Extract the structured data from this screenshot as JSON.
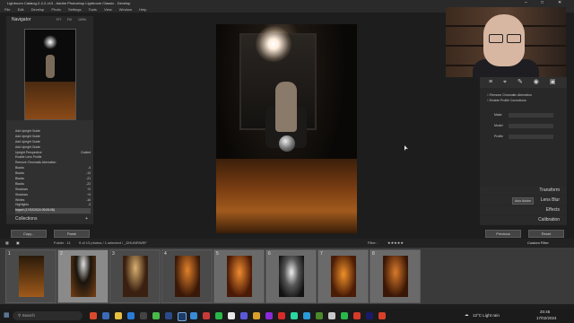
{
  "window": {
    "title": "Lightroom Catalog-2-2-2-v13 - Adobe Photoshop Lightroom Classic - Develop"
  },
  "menu": [
    "File",
    "Edit",
    "Develop",
    "Photo",
    "Settings",
    "Tools",
    "View",
    "Window",
    "Help"
  ],
  "navigator": {
    "label": "Navigator",
    "zoom_fit": "FIT",
    "zoom_fill": "Fill",
    "zoom_1": "100%",
    "zoom_2": "Fit"
  },
  "history": [
    {
      "label": "Add Upright Guide",
      "value": ""
    },
    {
      "label": "Add Upright Guide",
      "value": ""
    },
    {
      "label": "Add Upright Guide",
      "value": ""
    },
    {
      "label": "Add Upright Guide",
      "value": ""
    },
    {
      "label": "Upright Perspective",
      "value": "Guided"
    },
    {
      "label": "Enable Lens Profile",
      "value": ""
    },
    {
      "label": "Remove Chromatic Aberration",
      "value": ""
    },
    {
      "label": "Blacks",
      "value": "-4"
    },
    {
      "label": "Blacks",
      "value": "-13"
    },
    {
      "label": "Blacks",
      "value": "-21"
    },
    {
      "label": "Blacks",
      "value": "-22"
    },
    {
      "label": "Shadows",
      "value": "+2"
    },
    {
      "label": "Shadows",
      "value": "+4"
    },
    {
      "label": "Whites",
      "value": "-16"
    },
    {
      "label": "Highlights",
      "value": "-3"
    },
    {
      "label": "Import (17/02/2024 09:05:08)",
      "value": ""
    }
  ],
  "collections": {
    "label": "Collections"
  },
  "left_buttons": {
    "copy": "Copy...",
    "paste": "Paste"
  },
  "right_panel": {
    "remove_ca": "Remove Chromatic Aberration",
    "enable_profile": "Enable Profile Corrections",
    "fields": [
      "Make",
      "Model",
      "Profile"
    ],
    "sections": [
      "Transform",
      "Lens Blur",
      "Effects",
      "Calibration"
    ],
    "auto_button": "Auto Adobe",
    "previous": "Previous",
    "reset": "Reset"
  },
  "filmstrip": {
    "folder": "Folder : 11",
    "selection": "9 of 13 photos / 1 selected / _DHUNRWEF",
    "filter": "Filter :",
    "custom_filter": "Custom Filter",
    "thumbs": [
      "1",
      "2",
      "3",
      "4",
      "5",
      "6",
      "7",
      "8"
    ]
  },
  "taskbar": {
    "search_placeholder": "Search",
    "weather": "12°C  Light rain",
    "time": "20:46",
    "date": "17/02/2024"
  },
  "colors": {
    "accent": "#7fa8d8"
  }
}
